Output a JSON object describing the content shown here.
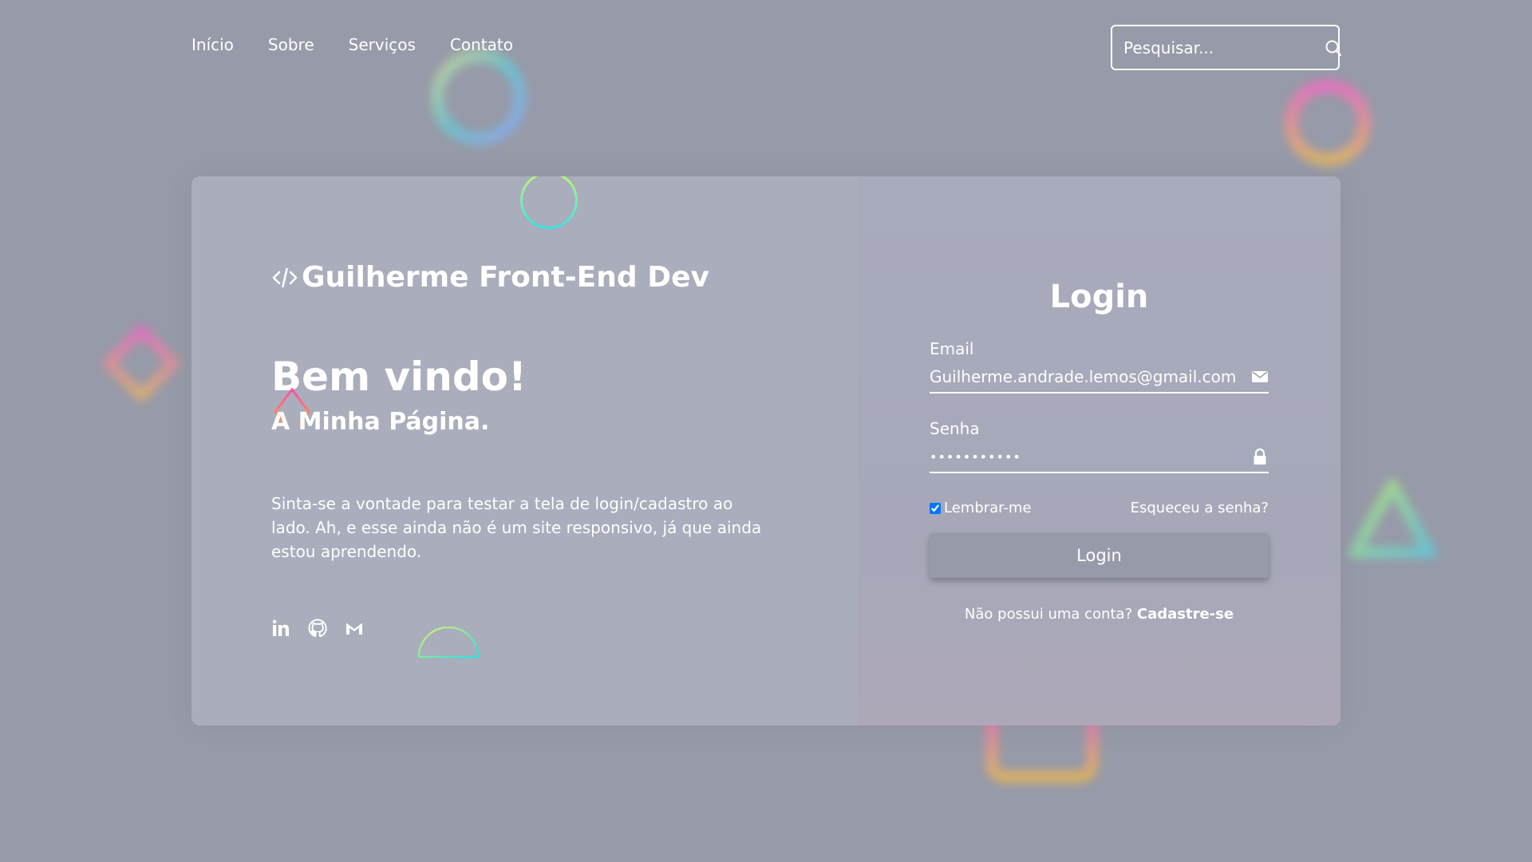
{
  "nav": {
    "items": [
      {
        "label": "Início"
      },
      {
        "label": "Sobre"
      },
      {
        "label": "Serviços"
      },
      {
        "label": "Contato"
      }
    ]
  },
  "search": {
    "placeholder": "Pesquisar...",
    "icon": "search-icon"
  },
  "intro": {
    "brand_icon": "code-icon",
    "brand": "Guilherme Front-End Dev",
    "welcome": "Bem vindo!",
    "subtitle": "A Minha Página.",
    "description": "Sinta-se a vontade para testar a tela de login/cadastro ao lado. Ah, e esse ainda não é um site responsivo, já que ainda estou aprendendo.",
    "socials": [
      "linkedin-icon",
      "github-icon",
      "gmail-icon"
    ]
  },
  "login": {
    "title": "Login",
    "email_label": "Email",
    "email_value": "Guilherme.andrade.lemos@gmail.com",
    "email_icon": "mail-icon",
    "password_label": "Senha",
    "password_value": "•••••••••••",
    "password_icon": "lock-icon",
    "remember_label": "Lembrar-me",
    "remember_checked": true,
    "forgot_label": "Esqueceu a senha?",
    "button_label": "Login",
    "signup_prompt": "Não possui uma conta?",
    "signup_link": "Cadastre-se"
  },
  "colors": {
    "background": "#979aa8",
    "card": "#a9adbc",
    "text": "#ffffff"
  }
}
